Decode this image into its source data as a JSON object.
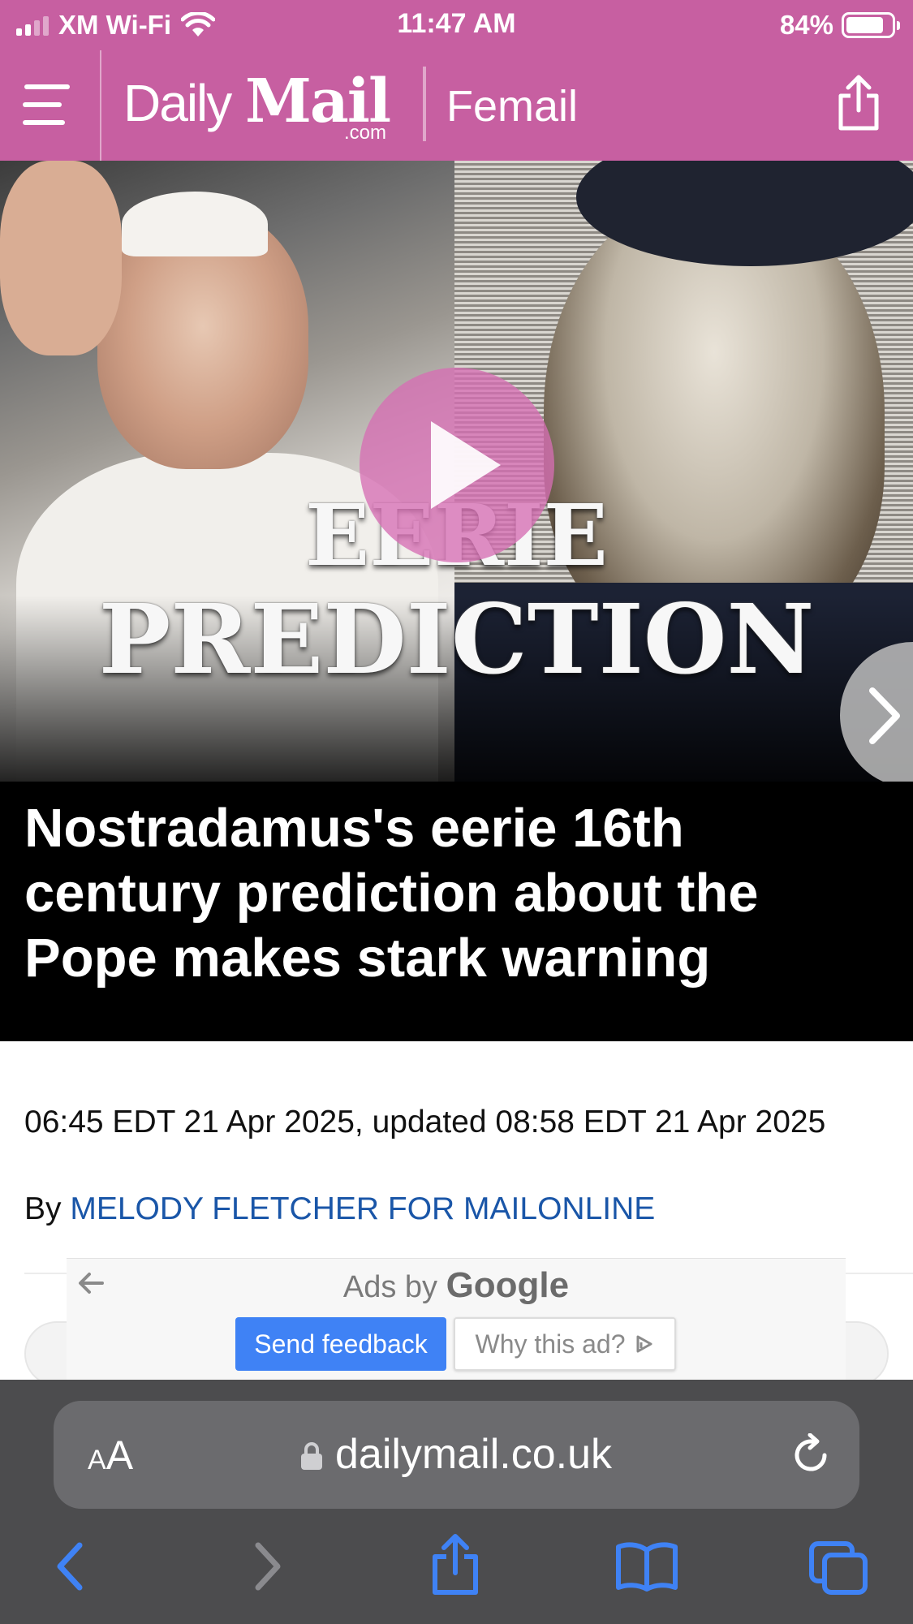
{
  "status_bar": {
    "carrier": "XM Wi-Fi",
    "time": "11:47 AM",
    "battery": "84%",
    "battery_level": 0.84,
    "icons": [
      "cellular-signal-icon",
      "wifi-icon",
      "battery-icon"
    ]
  },
  "site_header": {
    "logo": {
      "daily": "Daily",
      "mail": "Mail",
      "com": ".com"
    },
    "section": "Femail",
    "icons": [
      "hamburger-menu-icon",
      "share-icon"
    ],
    "color": "#c75fa1"
  },
  "hero": {
    "overlay_line1": "EERIE",
    "overlay_line2": "PREDICTION",
    "icons": [
      "play-icon",
      "chevron-right-icon"
    ]
  },
  "article": {
    "headline": "Nostradamus's eerie 16th century prediction about the Pope makes stark warning",
    "timestamp": "06:45 EDT 21 Apr 2025, updated 08:58 EDT 21 Apr 2025",
    "by_prefix": "By",
    "author": "MELODY FLETCHER FOR MAILONLINE",
    "author_color": "#1a56a8"
  },
  "ad": {
    "ads_by": "Ads by",
    "brand": "Google",
    "send_feedback": "Send feedback",
    "why_this_ad": "Why this ad?",
    "icons": [
      "back-arrow-icon",
      "adchoices-icon"
    ]
  },
  "safari": {
    "aa_label_small": "A",
    "aa_label_large": "A",
    "url": "dailymail.co.uk",
    "icons": [
      "lock-icon",
      "reload-icon",
      "back-icon",
      "forward-icon",
      "share-icon",
      "bookmarks-icon",
      "tabs-icon"
    ],
    "accent": "#3f82f5"
  }
}
